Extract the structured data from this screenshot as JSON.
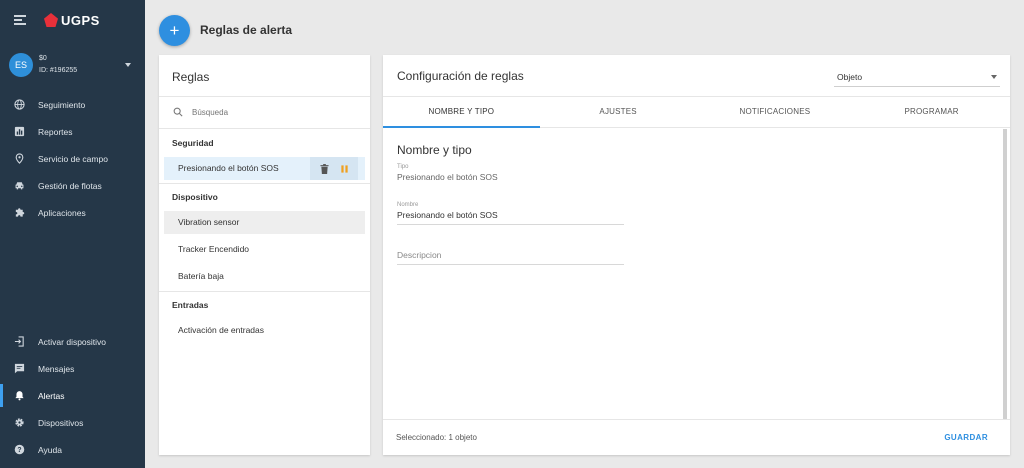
{
  "brand": {
    "name": "UGPS"
  },
  "account": {
    "initials": "ES",
    "balance": "$0",
    "id": "ID: #196255"
  },
  "nav_top": [
    {
      "label": "Seguimiento",
      "icon": "globe-icon"
    },
    {
      "label": "Reportes",
      "icon": "bar-chart-icon"
    },
    {
      "label": "Servicio de campo",
      "icon": "location-pin-icon"
    },
    {
      "label": "Gestión de flotas",
      "icon": "car-icon"
    },
    {
      "label": "Aplicaciones",
      "icon": "puzzle-icon"
    }
  ],
  "nav_bottom": [
    {
      "label": "Activar dispositivo",
      "icon": "login-icon"
    },
    {
      "label": "Mensajes",
      "icon": "message-icon"
    },
    {
      "label": "Alertas",
      "icon": "bell-icon"
    },
    {
      "label": "Dispositivos",
      "icon": "gear-icon"
    },
    {
      "label": "Ayuda",
      "icon": "help-icon"
    }
  ],
  "header": {
    "add_label": "+",
    "title": "Reglas de alerta"
  },
  "rules_panel": {
    "title": "Reglas",
    "search_placeholder": "Búsqueda",
    "groups": [
      {
        "title": "Seguridad",
        "items": [
          "Presionando el botón SOS"
        ]
      },
      {
        "title": "Dispositivo",
        "items": [
          "Vibration sensor",
          "Tracker Encendido",
          "Batería baja"
        ]
      },
      {
        "title": "Entradas",
        "items": [
          "Activación de entradas"
        ]
      }
    ]
  },
  "config": {
    "title": "Configuración de reglas",
    "select_value": "Objeto",
    "tabs": [
      "NOMBRE Y TIPO",
      "AJUSTES",
      "NOTIFICACIONES",
      "PROGRAMAR"
    ],
    "section_title": "Nombre y tipo",
    "type_label": "Tipo",
    "type_value": "Presionando el botón SOS",
    "name_label": "Nombre",
    "name_value": "Presionando el botón SOS",
    "description_placeholder": "Descripcion",
    "footer_status": "Seleccionado: 1 objeto",
    "save_label": "GUARDAR"
  },
  "colors": {
    "sidebar": "#253748",
    "accent": "#2e8fe0",
    "pause": "#f0a020"
  }
}
